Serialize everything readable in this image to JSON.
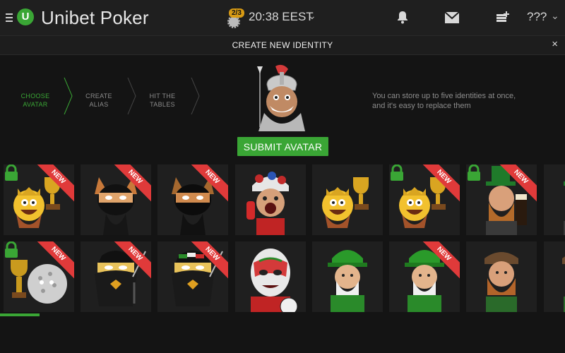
{
  "app": {
    "brand": "Unibet Poker",
    "logo_letter": "U",
    "session_count": "2/3",
    "time": "20:38 EEST",
    "account": "???"
  },
  "dialog": {
    "title": "CREATE NEW IDENTITY",
    "close": "×",
    "steps": [
      {
        "line1": "CHOOSE",
        "line2": "AVATAR",
        "active": true
      },
      {
        "line1": "CREATE",
        "line2": "ALIAS",
        "active": false
      },
      {
        "line1": "HIT THE",
        "line2": "TABLES",
        "active": false
      }
    ],
    "info": "You can store up to five identities at once, and it's easy to replace them",
    "submit_label": "SUBMIT AVATAR"
  },
  "avatars": [
    {
      "name": "trophy-king-emoji",
      "new": true,
      "locked": true
    },
    {
      "name": "ninja-cat",
      "new": true,
      "locked": false
    },
    {
      "name": "ninja-cat-dark",
      "new": true,
      "locked": false
    },
    {
      "name": "football-fan",
      "new": false,
      "locked": false
    },
    {
      "name": "trophy-king-emoji",
      "new": false,
      "locked": false
    },
    {
      "name": "trophy-king-emoji",
      "new": true,
      "locked": true
    },
    {
      "name": "leprechaun-beer",
      "new": true,
      "locked": true
    },
    {
      "name": "leprechaun-beer",
      "new": false,
      "locked": false
    },
    {
      "name": "golf-ball-trophy",
      "new": true,
      "locked": true
    },
    {
      "name": "ninja-penguin",
      "new": true,
      "locked": false
    },
    {
      "name": "ninja-penguin-italy",
      "new": true,
      "locked": false
    },
    {
      "name": "luchador-mask",
      "new": false,
      "locked": false
    },
    {
      "name": "leprechaun-elder",
      "new": false,
      "locked": false
    },
    {
      "name": "leprechaun-elder",
      "new": true,
      "locked": false
    },
    {
      "name": "highlander-bearded",
      "new": false,
      "locked": false
    },
    {
      "name": "highlander-bearded",
      "new": false,
      "locked": false
    }
  ],
  "ribbon_text": "NEW",
  "progress_fraction": 0.07,
  "colors": {
    "accent": "#3aa635",
    "ribbon": "#e03a3a",
    "badge": "#d79a14"
  }
}
